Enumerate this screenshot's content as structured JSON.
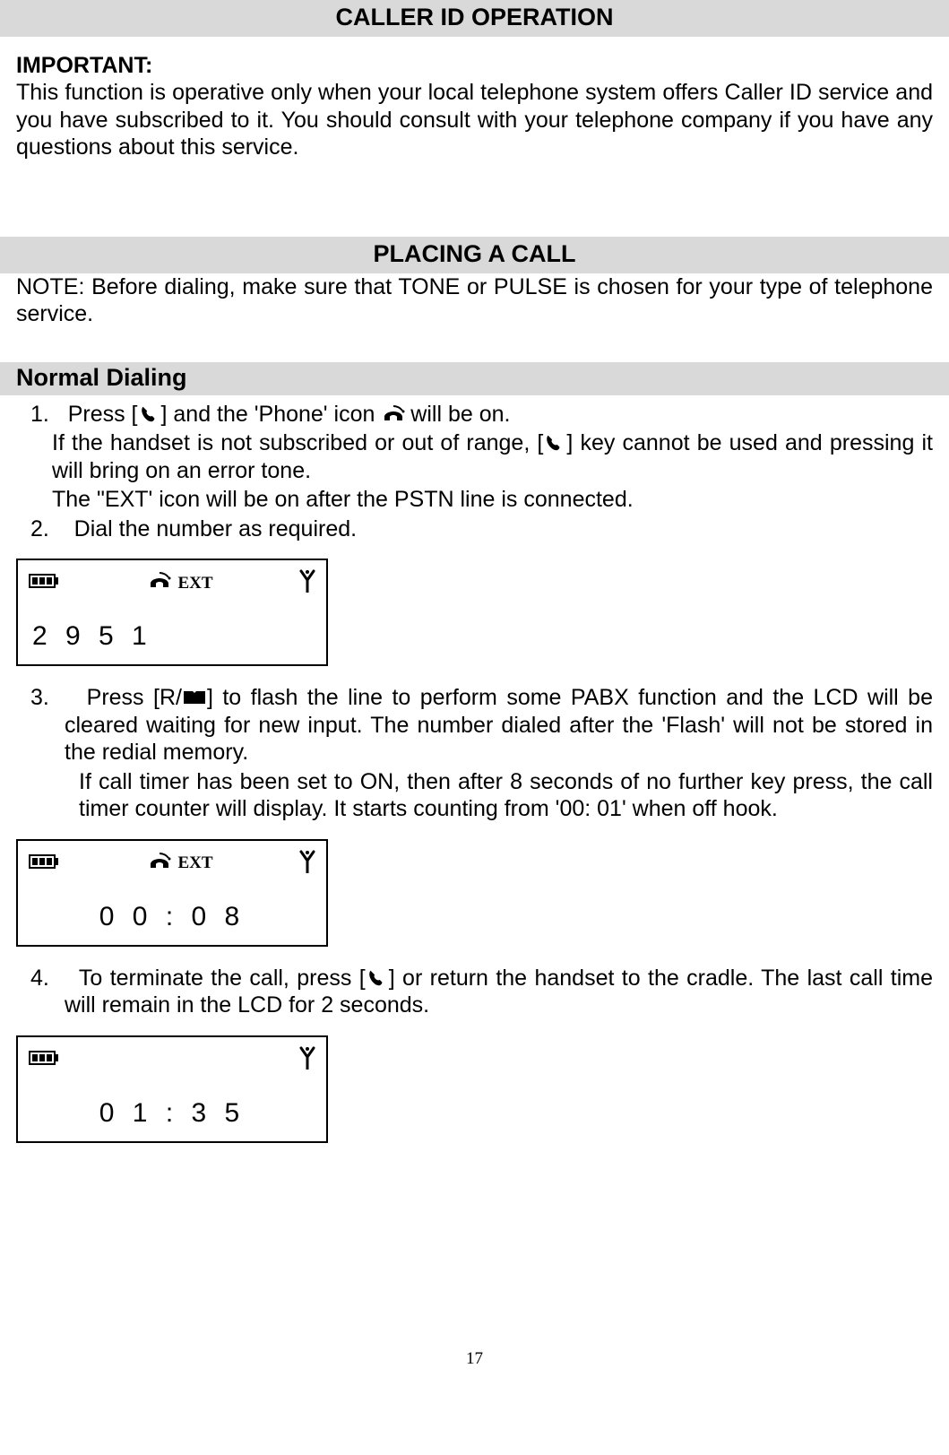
{
  "header1": "CALLER ID OPERATION",
  "important_label": "IMPORTANT:",
  "important_text": "This function is operative only when your local telephone system offers Caller ID service and you have subscribed to it. You should consult with your telephone company if you have any questions about this service.",
  "header2": "PLACING A CALL",
  "note_text": "NOTE: Before dialing, make sure that TONE or PULSE is chosen for your type of telephone service.",
  "subheader": "Normal Dialing",
  "step1_num": "1.",
  "step1a_pre": "Press [",
  "step1a_mid": "] and the 'Phone' icon ",
  "step1a_post": " will be on.",
  "step1b_pre": "If the handset is not subscribed or out of range, [",
  "step1b_post": "] key cannot be used and pressing it will bring on an error tone.",
  "step1c": "The \"EXT' icon will be on after the PSTN line is connected.",
  "step2_num": "2.",
  "step2": "Dial the number as required.",
  "lcd1_ext": "EXT",
  "lcd1_value": "2 9 5 1",
  "step3_num": "3.",
  "step3a_pre": "Press [R/",
  "step3a_post": "] to flash the line to perform some PABX function and the LCD will be cleared waiting for new input. The number dialed after the 'Flash' will not be stored in the redial memory.",
  "step3b": "If call timer has been set to ON, then after 8 seconds of no further key press, the call timer counter will display. It starts counting from '00: 01' when off hook.",
  "lcd2_ext": "EXT",
  "lcd2_value": "0 0 : 0 8",
  "step4_num": "4.",
  "step4_pre": "To terminate the call, press [",
  "step4_post": "] or return the handset to the cradle. The last call time will remain in the LCD for 2 seconds.",
  "lcd3_value": "0 1 : 3 5",
  "page_number": "17"
}
